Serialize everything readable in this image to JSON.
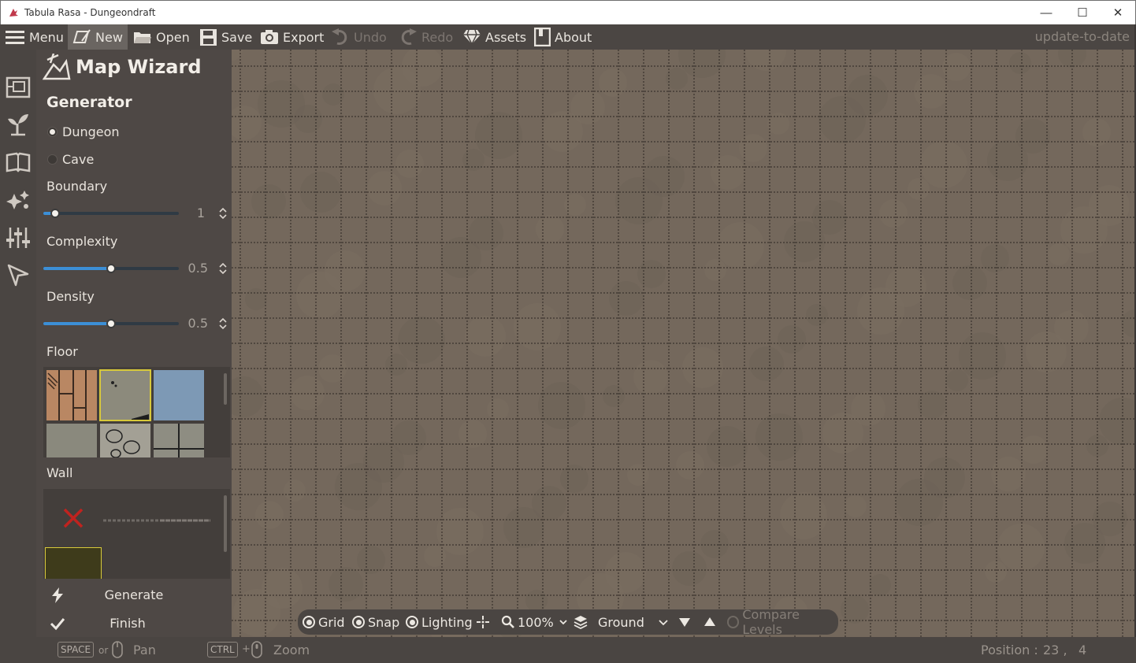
{
  "window": {
    "title": "Tabula Rasa - Dungeondraft",
    "minimize_icon": "minimize-icon",
    "maximize_icon": "maximize-icon",
    "close_icon": "close-icon",
    "minimize_glyph": "—",
    "maximize_glyph": "☐",
    "close_glyph": "✕"
  },
  "toolbar": {
    "menu": "Menu",
    "new": "New",
    "open": "Open",
    "save": "Save",
    "export": "Export",
    "undo": "Undo",
    "redo": "Redo",
    "assets": "Assets",
    "about": "About",
    "status": "update-to-date"
  },
  "panel": {
    "title": "Map Wizard",
    "generator_title": "Generator",
    "generator_options": [
      {
        "label": "Dungeon",
        "selected": true
      },
      {
        "label": "Cave",
        "selected": false
      }
    ],
    "boundary": {
      "label": "Boundary",
      "value": "1",
      "fraction": 0.09
    },
    "complexity": {
      "label": "Complexity",
      "value": "0.5",
      "fraction": 0.5
    },
    "density": {
      "label": "Density",
      "value": "0.5",
      "fraction": 0.5
    },
    "floor_label": "Floor",
    "wall_label": "Wall",
    "generate_label": "Generate",
    "finish_label": "Finish"
  },
  "map_toolbar": {
    "grid": "Grid",
    "snap": "Snap",
    "lighting": "Lighting",
    "zoom": "100%",
    "level": "Ground",
    "compare_levels": "Compare Levels"
  },
  "statusbar": {
    "space_key": "SPACE",
    "or_text": "or",
    "pan_label": "Pan",
    "ctrl_key": "CTRL",
    "plus_text": "+",
    "zoom_label": "Zoom",
    "position_label": "Position :",
    "pos_x": "23 ,",
    "pos_y": "4"
  },
  "colors": {
    "toolbar_bg": "#4b4643",
    "panel_bg": "#4e4845",
    "canvas_bg": "#74685c",
    "accent_blue": "#3c8fd6",
    "selected_outline": "#d8c93a"
  }
}
